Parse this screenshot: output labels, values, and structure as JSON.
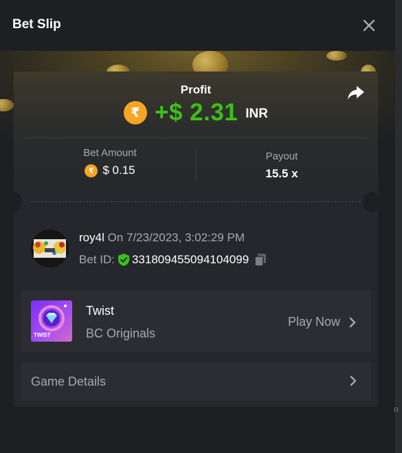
{
  "header": {
    "title": "Bet Slip"
  },
  "profit": {
    "label": "Profit",
    "currency_symbol": "₹",
    "amount": "+$ 2.31",
    "currency": "INR"
  },
  "stats": {
    "bet_amount_label": "Bet Amount",
    "bet_amount_symbol": "₹",
    "bet_amount_value": "$ 0.15",
    "payout_label": "Payout",
    "payout_value": "15.5 x"
  },
  "bet": {
    "username": "roy4l",
    "date_text": "On 7/23/2023, 3:02:29 PM",
    "bet_id_label": "Bet ID:",
    "bet_id": "3318094550941040​99"
  },
  "game": {
    "name": "Twist",
    "provider": "BC Originals",
    "play_label": "Play Now",
    "thumb_text": "TWIST"
  },
  "details": {
    "label": "Game Details"
  },
  "side_text": "o",
  "colors": {
    "background": "#1d1f23",
    "card": "#25272c",
    "row": "#2b2d32",
    "profit_green": "#3bc117",
    "rupee_orange": "#f5a623",
    "muted_text": "#a6a9ae"
  }
}
